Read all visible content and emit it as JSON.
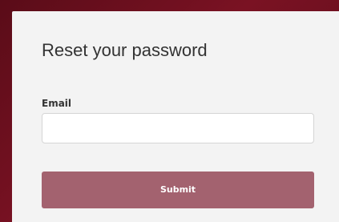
{
  "form": {
    "title": "Reset your password",
    "email_label": "Email",
    "email_value": "",
    "email_placeholder": "",
    "submit_label": "Submit"
  },
  "colors": {
    "background": "#6e1020",
    "card": "#f3f3f3",
    "button": "#a3626f",
    "button_text": "#ffffff",
    "text": "#333333"
  }
}
